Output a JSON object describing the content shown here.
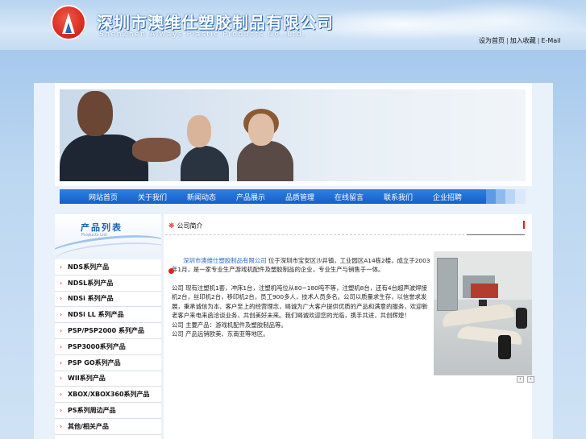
{
  "header": {
    "company_cn": "深圳市澳维仕塑胶制品有限公司",
    "company_en": "ShenZhen Always Plastic Products Co.,Ltd.",
    "top_links": [
      "设为首页",
      "加入收藏",
      "E-Mail"
    ],
    "link_separator": "|"
  },
  "nav": {
    "items": [
      "网站首页",
      "关于我们",
      "新闻动态",
      "产品展示",
      "品质管理",
      "在线留言",
      "联系我们",
      "企业招聘"
    ]
  },
  "sidebar": {
    "title": "产品列表",
    "subtitle": "Products List",
    "items": [
      "NDS系列产品",
      "NDSL系列产品",
      "NDSi 系列产品",
      "NDSi LL 系列产品",
      "PSP/PSP2000 系列产品",
      "PSP3000系列产品",
      "PSP GO系列产品",
      "WII系列产品",
      "XBOX/XBOX360系列产品",
      "PS系列周边产品",
      "其他/相关产品"
    ]
  },
  "content": {
    "section_title": "公司简介",
    "company_link": "深圳市澳维仕塑胶制品有限公司",
    "intro_text": "位于深圳市宝安区沙井镇，工业园区A14栋2楼，成立于2003年1月，是一家专业生产游戏机配件及塑胶制品的企业，专业生产与销售于一体。",
    "body_text": "公司 现有注塑机1套，冲床1台，注塑机吨位从80~180吨不等，注塑机8台，还有4台超声波焊接机2台，丝印机2台，移印机2台，员工900多人，技术人员多名。公司以质量求生存，以信誉求发展，秉承诚信为本、客户至上的经营理念，竭诚为广大客户提供优质的产品和满意的服务，欢迎新老客户来电来函洽谈业务，共创美好未来。我们竭诚欢迎您的光临，携手共进，共创辉煌！",
    "line3": "公司 主要产品：游戏机配件及塑胶制品等。",
    "line4": "公司 产品远销欧美、东南亚等地区。"
  },
  "pager": {
    "prev": "‹",
    "next": "›"
  },
  "colors": {
    "nav_blue": "#1461c9",
    "logo_red": "#d4261c",
    "link_blue": "#2a68c2"
  }
}
